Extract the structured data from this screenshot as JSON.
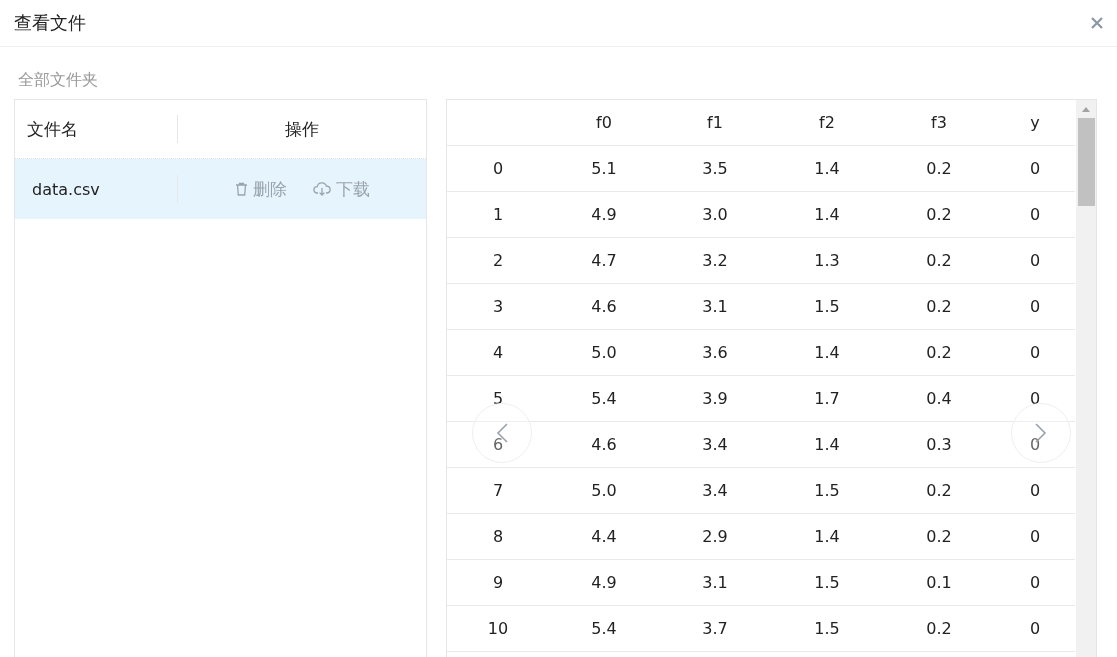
{
  "dialog": {
    "title": "查看文件"
  },
  "breadcrumb": "全部文件夹",
  "file_table": {
    "columns": [
      "文件名",
      "操作"
    ],
    "rows": [
      {
        "name": "data.csv",
        "selected": true,
        "actions": [
          {
            "kind": "delete",
            "label": "删除"
          },
          {
            "kind": "download",
            "label": "下载"
          }
        ]
      }
    ]
  },
  "data_table": {
    "columns": [
      "",
      "f0",
      "f1",
      "f2",
      "f3",
      "y"
    ],
    "rows": [
      [
        "0",
        "5.1",
        "3.5",
        "1.4",
        "0.2",
        "0"
      ],
      [
        "1",
        "4.9",
        "3.0",
        "1.4",
        "0.2",
        "0"
      ],
      [
        "2",
        "4.7",
        "3.2",
        "1.3",
        "0.2",
        "0"
      ],
      [
        "3",
        "4.6",
        "3.1",
        "1.5",
        "0.2",
        "0"
      ],
      [
        "4",
        "5.0",
        "3.6",
        "1.4",
        "0.2",
        "0"
      ],
      [
        "5",
        "5.4",
        "3.9",
        "1.7",
        "0.4",
        "0"
      ],
      [
        "6",
        "4.6",
        "3.4",
        "1.4",
        "0.3",
        "0"
      ],
      [
        "7",
        "5.0",
        "3.4",
        "1.5",
        "0.2",
        "0"
      ],
      [
        "8",
        "4.4",
        "2.9",
        "1.4",
        "0.2",
        "0"
      ],
      [
        "9",
        "4.9",
        "3.1",
        "1.5",
        "0.1",
        "0"
      ],
      [
        "10",
        "5.4",
        "3.7",
        "1.5",
        "0.2",
        "0"
      ]
    ]
  }
}
